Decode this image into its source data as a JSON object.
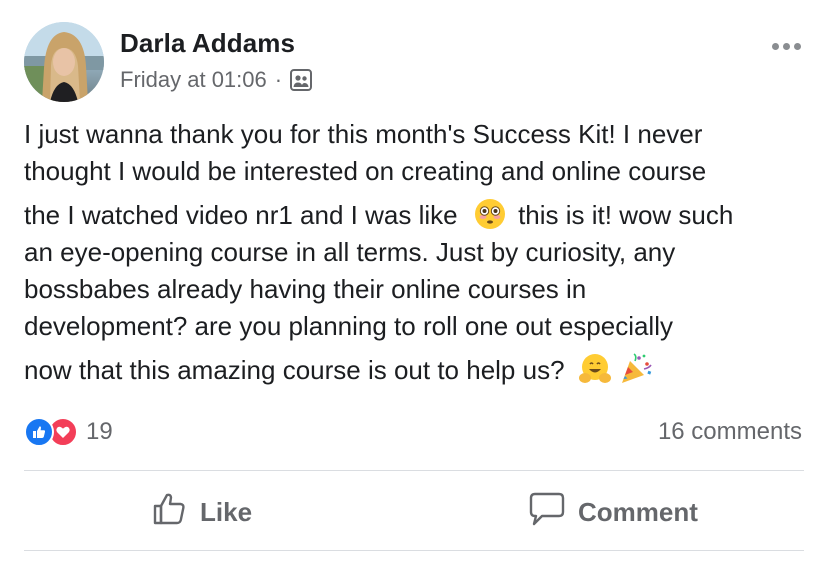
{
  "post": {
    "author": "Darla Addams",
    "timestamp": "Friday at 01:06",
    "separator": "·",
    "audience_icon": "group-privacy-icon",
    "body_lines": [
      "I just wanna thank you for this month's Success Kit! I never",
      "thought I would be interested on creating and online course",
      "the I watched video nr1 and I was like",
      "this is it! wow such",
      "an eye-opening course in all terms. Just by curiosity, any",
      "bossbabes already having their online courses in",
      "development? are you planning to roll one out especially",
      "now that this amazing course is out to help us?"
    ],
    "emojis": [
      "flushed-face-emoji",
      "hugging-face-emoji",
      "party-popper-emoji"
    ]
  },
  "reactions": {
    "types": [
      "like",
      "love"
    ],
    "count": "19"
  },
  "comments": {
    "count_label": "16 comments"
  },
  "actions": {
    "like_label": "Like",
    "comment_label": "Comment"
  },
  "colors": {
    "like_blue": "#1877f2",
    "love_red": "#f33e58",
    "secondary_text": "#65676b"
  }
}
